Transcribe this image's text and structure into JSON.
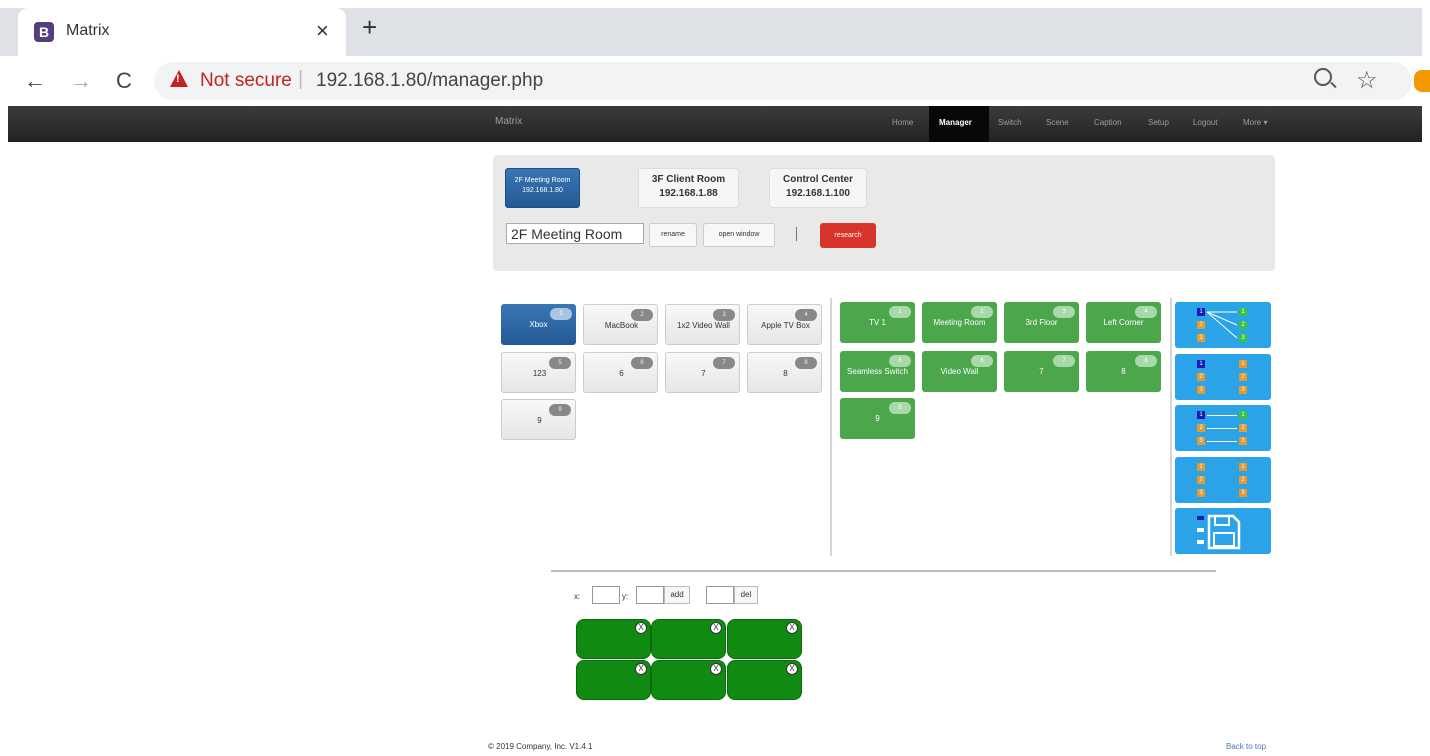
{
  "browser": {
    "tab_title": "Matrix",
    "tab_favicon": "B",
    "new_tab": "+",
    "close": "×",
    "back": "←",
    "forward": "→",
    "reload": "C",
    "security_label": "Not secure",
    "separator": "|",
    "url": "192.168.1.80/manager.php",
    "star": "☆"
  },
  "navbar": {
    "brand": "Matrix",
    "links": [
      "Home",
      "Manager",
      "Switch",
      "Scene",
      "Caption",
      "Setup",
      "Logout",
      "More ▾"
    ],
    "active": "Manager"
  },
  "devices": [
    {
      "name": "2F Meeting Room",
      "ip": "192.168.1.80",
      "active": true
    },
    {
      "name": "3F Client Room",
      "ip": "192.168.1.88",
      "active": false
    },
    {
      "name": "Control Center",
      "ip": "192.168.1.100",
      "active": false
    }
  ],
  "device_controls": {
    "name_value": "2F Meeting Room",
    "rename_label": "rename",
    "open_window_label": "open window",
    "research_label": "research"
  },
  "inputs": [
    {
      "label": "Xbox",
      "num": "1",
      "selected": true
    },
    {
      "label": "MacBook",
      "num": "2"
    },
    {
      "label": "1x2 Video Wall",
      "num": "3"
    },
    {
      "label": "Apple TV Box",
      "num": "4"
    },
    {
      "label": "123",
      "num": "5"
    },
    {
      "label": "6",
      "num": "6"
    },
    {
      "label": "7",
      "num": "7"
    },
    {
      "label": "8",
      "num": "8"
    },
    {
      "label": "9",
      "num": "9"
    }
  ],
  "outputs": [
    {
      "label": "TV 1",
      "num": "1"
    },
    {
      "label": "Meeting Room",
      "num": "2"
    },
    {
      "label": "3rd Floor",
      "num": "3"
    },
    {
      "label": "Left Corner",
      "num": "4"
    },
    {
      "label": "Seamless Switch",
      "num": "5"
    },
    {
      "label": "Video Wall",
      "num": "6"
    },
    {
      "label": "7",
      "num": "7"
    },
    {
      "label": "8",
      "num": "8"
    },
    {
      "label": "9",
      "num": "9"
    }
  ],
  "modes": {
    "digits": [
      "1",
      "2",
      "3"
    ],
    "icons": [
      "fan-out-mode-icon",
      "parallel-mode-icon",
      "one-to-one-mode-icon",
      "reset-mode-icon",
      "save-icon"
    ]
  },
  "xy": {
    "x_label": "x:",
    "y_label": "y:",
    "add_label": "add",
    "del_label": "del"
  },
  "video_wall": {
    "rows": 2,
    "cols": 3,
    "remove_glyph": "X"
  },
  "footer": {
    "copyright": "© 2019 Company, Inc. V1.4.1",
    "back_to_top": "Back to top"
  },
  "colors": {
    "input_tile": "#e6e6e6",
    "selected_tile": "#2d67a8",
    "output_tile": "#4ca64c",
    "mode_tile": "#2aa3e8",
    "research": "#d9342b",
    "wall_cell": "#108a10"
  }
}
